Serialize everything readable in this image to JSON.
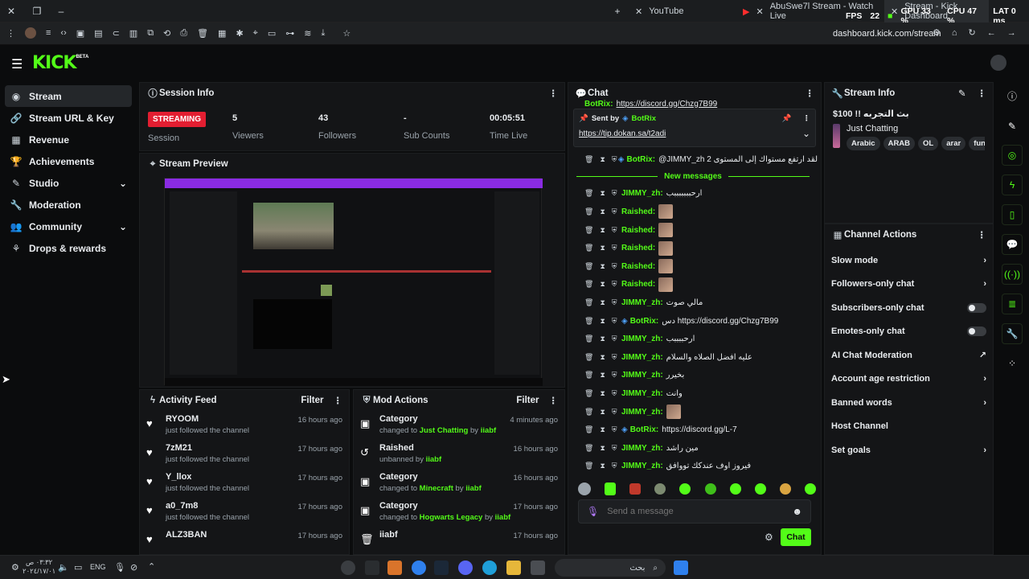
{
  "browser": {
    "tabs": [
      {
        "title": "YouTube"
      },
      {
        "title": "AbuSwe7l Stream - Watch Live"
      },
      {
        "title": "Stream - Kick Dashboard"
      }
    ],
    "url": "dashboard.kick.com/stream",
    "overlay": {
      "fps_label": "FPS",
      "fps": "22",
      "gpu": "GPU 33 %",
      "cpu": "CPU 47 %",
      "lat": "LAT 0 ms"
    }
  },
  "app": {
    "logo": "KICK",
    "logo_sup": "BETA"
  },
  "sidebar": {
    "items": [
      {
        "label": "Stream",
        "icon": "stream-icon"
      },
      {
        "label": "Stream URL & Key",
        "icon": "link-icon"
      },
      {
        "label": "Revenue",
        "icon": "revenue-icon"
      },
      {
        "label": "Achievements",
        "icon": "trophy-icon"
      },
      {
        "label": "Studio",
        "icon": "studio-icon"
      },
      {
        "label": "Moderation",
        "icon": "wrench-icon"
      },
      {
        "label": "Community",
        "icon": "community-icon"
      },
      {
        "label": "Drops & rewards",
        "icon": "drops-icon"
      }
    ]
  },
  "session": {
    "title": "Session Info",
    "status": "STREAMING",
    "status_label": "Session",
    "viewers": "5",
    "viewers_label": "Viewers",
    "followers": "43",
    "followers_label": "Followers",
    "subs": "-",
    "subs_label": "Sub Counts",
    "time": "00:05:51",
    "time_label": "Time Live"
  },
  "preview": {
    "title": "Stream Preview"
  },
  "activity": {
    "title": "Activity Feed",
    "filter": "Filter",
    "items": [
      {
        "name": "RYOOM",
        "sub": "just followed the channel",
        "time": "16 hours ago"
      },
      {
        "name": "7zM21",
        "sub": "just followed the channel",
        "time": "17 hours ago"
      },
      {
        "name": "Y_llox",
        "sub": "just followed the channel",
        "time": "17 hours ago"
      },
      {
        "name": "a0_7m8",
        "sub": "just followed the channel",
        "time": "17 hours ago"
      },
      {
        "name": "ALZ3BAN",
        "sub": "",
        "time": "17 hours ago"
      }
    ]
  },
  "mod_actions": {
    "title": "Mod Actions",
    "filter": "Filter",
    "items": [
      {
        "title": "Category",
        "pre": "changed to",
        "target": "Just Chatting",
        "by": "by",
        "user": "iiabf",
        "time": "4 minutes ago"
      },
      {
        "title": "Raished",
        "pre": "unbanned by",
        "target": "",
        "by": "",
        "user": "iiabf",
        "time": "16 hours ago"
      },
      {
        "title": "Category",
        "pre": "changed to",
        "target": "Minecraft",
        "by": "by",
        "user": "iiabf",
        "time": "16 hours ago"
      },
      {
        "title": "Category",
        "pre": "changed to",
        "target": "Hogwarts Legacy",
        "by": "by",
        "user": "iiabf",
        "time": "17 hours ago"
      },
      {
        "title": "iiabf",
        "pre": "",
        "target": "",
        "by": "",
        "user": "",
        "time": "17 hours ago"
      }
    ]
  },
  "chat": {
    "title": "Chat",
    "top_partial_user": "BotRix:",
    "top_partial_text": "https://discord.gg/Chzg7B99",
    "pinned_sent_by": "Sent by",
    "pinned_user": "BotRix",
    "pinned_link": "https://tip.dokan.sa/t2adi",
    "first_msg_user": "BotRix:",
    "first_msg_text": "@JIMMY_zh لقد ارتفع مستواك إلى المستوى 2",
    "new_messages": "New messages",
    "messages": [
      {
        "user": "JIMMY_zh:",
        "text": "ارحبببببببب",
        "emote": false,
        "bot": false
      },
      {
        "user": "Raished:",
        "text": "",
        "emote": true,
        "bot": false
      },
      {
        "user": "Raished:",
        "text": "",
        "emote": true,
        "bot": false
      },
      {
        "user": "Raished:",
        "text": "",
        "emote": true,
        "bot": false
      },
      {
        "user": "Raished:",
        "text": "",
        "emote": true,
        "bot": false
      },
      {
        "user": "Raished:",
        "text": "",
        "emote": true,
        "bot": false
      },
      {
        "user": "JIMMY_zh:",
        "text": "مالي صوت",
        "emote": false,
        "bot": false
      },
      {
        "user": "BotRix:",
        "text": "دس https://discord.gg/Chzg7B99",
        "emote": false,
        "bot": true
      },
      {
        "user": "JIMMY_zh:",
        "text": "ارحببببب",
        "emote": false,
        "bot": false
      },
      {
        "user": "JIMMY_zh:",
        "text": "عليه افضل الصلاه والسلام",
        "emote": false,
        "bot": false
      },
      {
        "user": "JIMMY_zh:",
        "text": "بخيرر",
        "emote": false,
        "bot": false
      },
      {
        "user": "JIMMY_zh:",
        "text": "وانت",
        "emote": false,
        "bot": false
      },
      {
        "user": "JIMMY_zh:",
        "text": "",
        "emote": true,
        "bot": false
      },
      {
        "user": "BotRix:",
        "text": "https://discord.gg/L-7",
        "emote": false,
        "bot": true
      },
      {
        "user": "JIMMY_zh:",
        "text": "مين راشد",
        "emote": false,
        "bot": false
      },
      {
        "user": "JIMMY_zh:",
        "text": "فيروز اوف عندكك تووافق",
        "emote": false,
        "bot": false
      }
    ],
    "input_placeholder": "Send a message",
    "send_label": "Chat"
  },
  "stream_info": {
    "title": "Stream Info",
    "stream_title": "بث التجربه !! 100$",
    "category": "Just Chatting",
    "tags": [
      "Arabic",
      "ARAB",
      "OL",
      "arar",
      "funny"
    ]
  },
  "channel_actions": {
    "title": "Channel Actions",
    "items": [
      {
        "label": "Slow mode",
        "control": "chevron"
      },
      {
        "label": "Followers-only chat",
        "control": "chevron"
      },
      {
        "label": "Subscribers-only chat",
        "control": "toggle"
      },
      {
        "label": "Emotes-only chat",
        "control": "toggle"
      },
      {
        "label": "AI Chat Moderation",
        "control": "external"
      },
      {
        "label": "Account age restriction",
        "control": "chevron"
      },
      {
        "label": "Banned words",
        "control": "chevron"
      },
      {
        "label": "Host Channel",
        "control": "none"
      },
      {
        "label": "Set goals",
        "control": "chevron"
      }
    ]
  },
  "taskbar": {
    "time": "٠٣:٣٢ ص",
    "date": "٢٠٢٤/١٧/٠١",
    "lang": "ENG",
    "search_placeholder": "بحث"
  },
  "colors": {
    "accent": "#53fc18",
    "live": "#e21e31",
    "bg": "#0b0c0d",
    "panel": "#141517"
  }
}
